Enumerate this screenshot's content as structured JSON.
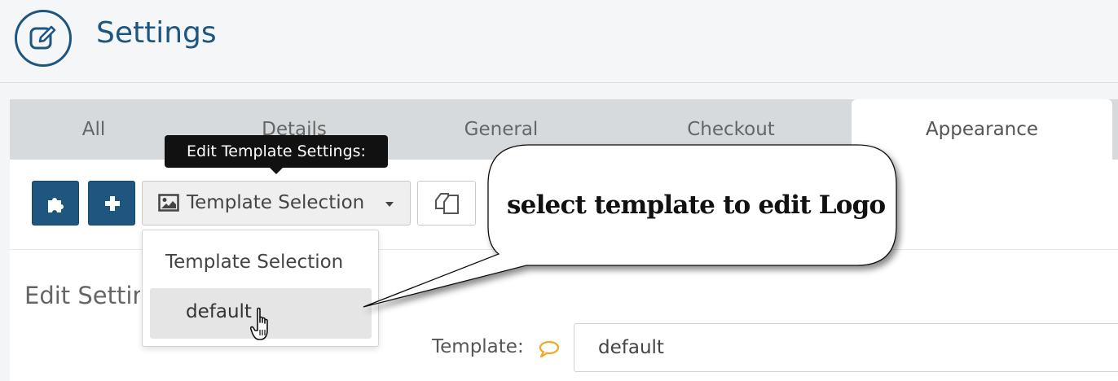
{
  "header": {
    "title": "Settings",
    "icon": "edit-icon",
    "accent_color": "#1e5680"
  },
  "tabs": [
    {
      "label": "All"
    },
    {
      "label": "Details"
    },
    {
      "label": "General"
    },
    {
      "label": "Checkout"
    },
    {
      "label": "Appearance",
      "active": true
    }
  ],
  "toolbar": {
    "plugin_button_icon": "puzzle-icon",
    "add_button_icon": "plus-icon",
    "template_dropdown": {
      "icon": "image-icon",
      "label": "Template Selection"
    },
    "copy_button_icon": "copy-icon",
    "tooltip": "Edit Template Settings:"
  },
  "dropdown_menu": {
    "header": "Template Selection",
    "items": [
      {
        "label": "default",
        "hovered": true
      }
    ]
  },
  "section": {
    "title": "Edit Settings"
  },
  "form": {
    "template_label": "Template:",
    "template_value": "default",
    "comment_icon_color": "#f5a623"
  },
  "callout": {
    "text": "select template to edit Logo"
  }
}
